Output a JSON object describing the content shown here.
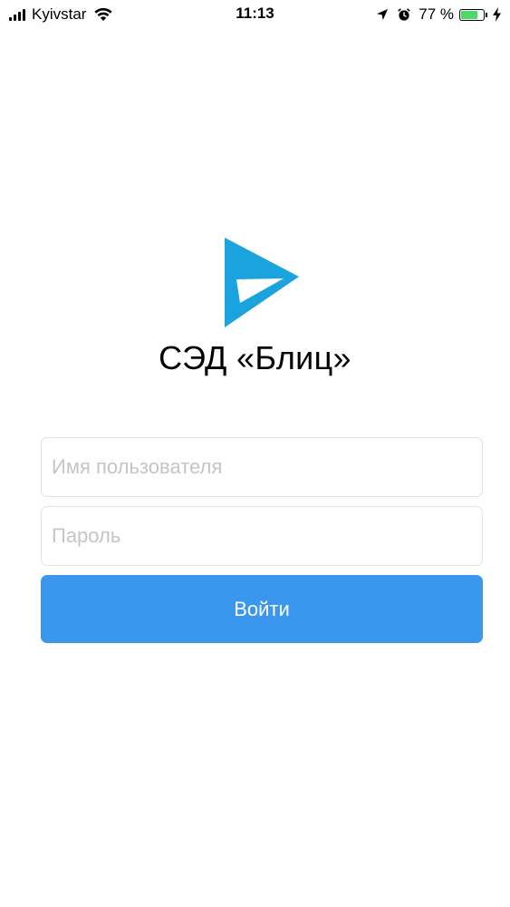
{
  "status_bar": {
    "carrier": "Kyivstar",
    "time": "11:13",
    "battery_percent": "77 %",
    "battery_level": 0.77,
    "icons": [
      "signal-icon",
      "wifi-icon",
      "location-arrow-icon",
      "alarm-icon",
      "battery-icon",
      "charging-bolt-icon"
    ]
  },
  "app": {
    "title": "СЭД «Блиц»",
    "brand_color": "#1aa3dd",
    "logo_icon": "play-triangle-logo"
  },
  "login_form": {
    "username_placeholder": "Имя пользователя",
    "password_placeholder": "Пароль",
    "submit_label": "Войти",
    "button_color": "#3b96ee"
  }
}
